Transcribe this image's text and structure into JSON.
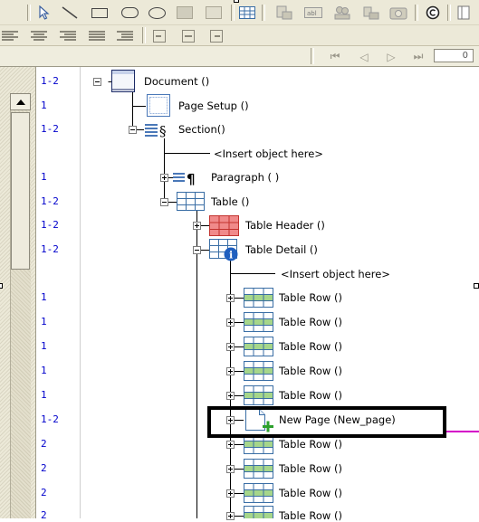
{
  "toolbar": {
    "draw_tools": [
      "pointer-icon",
      "line-icon",
      "rectangle-icon",
      "rounded-rectangle-icon",
      "ellipse-icon",
      "image-icon",
      "frame-icon",
      "table-icon",
      "barcode-icon",
      "text-field-icon",
      "users-icon",
      "chart-icon",
      "picture-icon",
      "copyright-icon",
      "page-icon"
    ],
    "align_tools": [
      "align-left-icon",
      "align-center-icon",
      "align-right-icon",
      "justify-icon",
      "indent-icon",
      "frame-left-icon",
      "frame-center-icon",
      "frame-right-icon"
    ],
    "nav": {
      "first": "⏮",
      "prev": "◁",
      "next": "▷",
      "last": "⏭",
      "page_value": "0"
    }
  },
  "tree": {
    "nodes": [
      {
        "line": "1-2",
        "label": "Document ()",
        "icon": "document-icon"
      },
      {
        "line": "1",
        "label": "Page Setup ()",
        "icon": "page-setup-icon"
      },
      {
        "line": "1-2",
        "label": "Section()",
        "icon": "section-icon"
      },
      {
        "line": "",
        "label": "<Insert object here>",
        "icon": ""
      },
      {
        "line": "1",
        "label": "Paragraph (   )",
        "icon": "paragraph-icon"
      },
      {
        "line": "1-2",
        "label": "Table ()",
        "icon": "table-icon"
      },
      {
        "line": "1-2",
        "label": "Table Header ()",
        "icon": "table-header-icon"
      },
      {
        "line": "1-2",
        "label": "Table Detail ()",
        "icon": "table-detail-icon"
      },
      {
        "line": "",
        "label": "<Insert object here>",
        "icon": ""
      },
      {
        "line": "1",
        "label": "Table Row ()",
        "icon": "table-row-icon"
      },
      {
        "line": "1",
        "label": "Table Row ()",
        "icon": "table-row-icon"
      },
      {
        "line": "1",
        "label": "Table Row ()",
        "icon": "table-row-icon"
      },
      {
        "line": "1",
        "label": "Table Row ()",
        "icon": "table-row-icon"
      },
      {
        "line": "1",
        "label": "Table Row ()",
        "icon": "table-row-icon"
      },
      {
        "line": "1-2",
        "label": "New Page (New_page)",
        "icon": "new-page-icon"
      },
      {
        "line": "2",
        "label": "Table Row ()",
        "icon": "table-row-icon"
      },
      {
        "line": "2",
        "label": "Table Row ()",
        "icon": "table-row-icon"
      },
      {
        "line": "2",
        "label": "Table Row ()",
        "icon": "table-row-icon"
      },
      {
        "line": "2",
        "label": "Table Row ()",
        "icon": "table-row-icon"
      }
    ]
  },
  "colors": {
    "toolbar_bg": "#ece9d8",
    "line_number": "#0000cc",
    "highlight_border": "#000000",
    "connector_line": "#d400c8",
    "table_grid": "#3a6ea5",
    "table_row_fill": "#a6d68a",
    "table_header_fill": "#f08a8a",
    "info_badge": "#1f5fbf",
    "add_plus": "#2ca02c"
  }
}
